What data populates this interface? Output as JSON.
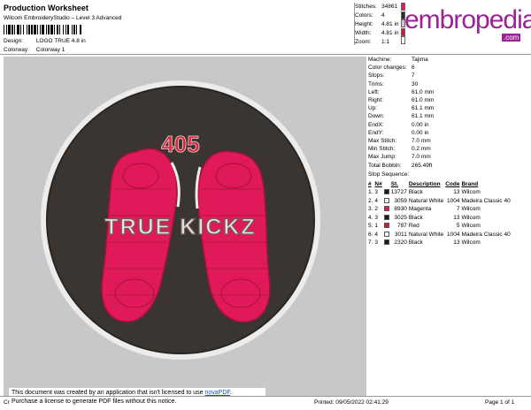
{
  "header": {
    "title": "Production Worksheet",
    "subtitle": "Wilcom EmbroideryStudio – Level 3 Advanced",
    "design_label": "Design:",
    "design_value": "LOGO TRUE 4.8 in",
    "colorway_label": "Colorway:",
    "colorway_value": "Colorway 1"
  },
  "summary": {
    "stitches_label": "Stitches:",
    "stitches": "34861",
    "colors_label": "Colors:",
    "colors": "4",
    "height_label": "Height:",
    "height": "4.81 in",
    "width_label": "Width:",
    "width": "4.81 in",
    "zoom_label": "Zoom:",
    "zoom": "1:1",
    "swatch_colors": [
      "#e0195a",
      "#2a2a2a",
      "#d0c9c9",
      "#c81e3c",
      "#ffffff"
    ]
  },
  "logo": {
    "text": "embropedia",
    "com": ".com",
    "color": "#9b2396"
  },
  "design": {
    "number_text": "405",
    "brand_text": "TRUE KICKZ",
    "bg_color": "#c8c8c8",
    "badge_fill": "#3a3530",
    "ring_color": "#ececec",
    "sole_color": "#e0195a",
    "number_color": "#d42a3f"
  },
  "machine": {
    "machine_label": "Machine:",
    "machine": "Tajima",
    "color_changes_label": "Color changes:",
    "color_changes": "6",
    "stops_label": "Stops:",
    "stops": "7",
    "trims_label": "Trims:",
    "trims": "30",
    "left_label": "Left:",
    "left": "61.0 mm",
    "right_label": "Right:",
    "right": "61.0 mm",
    "up_label": "Up:",
    "up": "61.1 mm",
    "down_label": "Down:",
    "down": "61.1 mm",
    "endx_label": "EndX:",
    "endx": "0.00 in",
    "endy_label": "EndY:",
    "endy": "0.00 in",
    "max_stitch_label": "Max Stitch:",
    "max_stitch": "7.0 mm",
    "min_stitch_label": "Min Stitch:",
    "min_stitch": "0.2 mm",
    "max_jump_label": "Max Jump:",
    "max_jump": "7.0 mm",
    "total_bobbin_label": "Total Bobbin:",
    "total_bobbin": "265.49ft"
  },
  "stop_sequence": {
    "title": "Stop Sequence:",
    "headers": [
      "#",
      "N#",
      "",
      "St.",
      "Description",
      "Code",
      "Brand"
    ],
    "rows": [
      {
        "num": "1.",
        "n": "3",
        "color": "#1a1a1a",
        "st": "13727",
        "desc": "Black",
        "code": "13",
        "brand": "Wilcom"
      },
      {
        "num": "2.",
        "n": "4",
        "color": "#f2f2f2",
        "st": "3059",
        "desc": "Natural White",
        "code": "1004",
        "brand": "Madeira Classic 40"
      },
      {
        "num": "3.",
        "n": "2",
        "color": "#e0195a",
        "st": "8930",
        "desc": "Magenta",
        "code": "7",
        "brand": "Wilcom"
      },
      {
        "num": "4.",
        "n": "3",
        "color": "#1a1a1a",
        "st": "3025",
        "desc": "Black",
        "code": "13",
        "brand": "Wilcom"
      },
      {
        "num": "5.",
        "n": "1",
        "color": "#d21e2e",
        "st": "787",
        "desc": "Red",
        "code": "5",
        "brand": "Wilcom"
      },
      {
        "num": "6.",
        "n": "4",
        "color": "#f2f2f2",
        "st": "3011",
        "desc": "Natural White",
        "code": "1004",
        "brand": "Madeira Classic 40"
      },
      {
        "num": "7.",
        "n": "3",
        "color": "#1a1a1a",
        "st": "2320",
        "desc": "Black",
        "code": "13",
        "brand": "Wilcom"
      }
    ]
  },
  "notice": {
    "line1_prefix": "This document was created by an application that isn't licensed to use ",
    "link": "novaPDF",
    "line1_suffix": ".",
    "line2": "Purchase a license to generate PDF files without this notice."
  },
  "footer": {
    "cr": "Cr",
    "printed": "Printed: 09/05/2022 02:41:29",
    "page": "Page 1 of 1"
  }
}
